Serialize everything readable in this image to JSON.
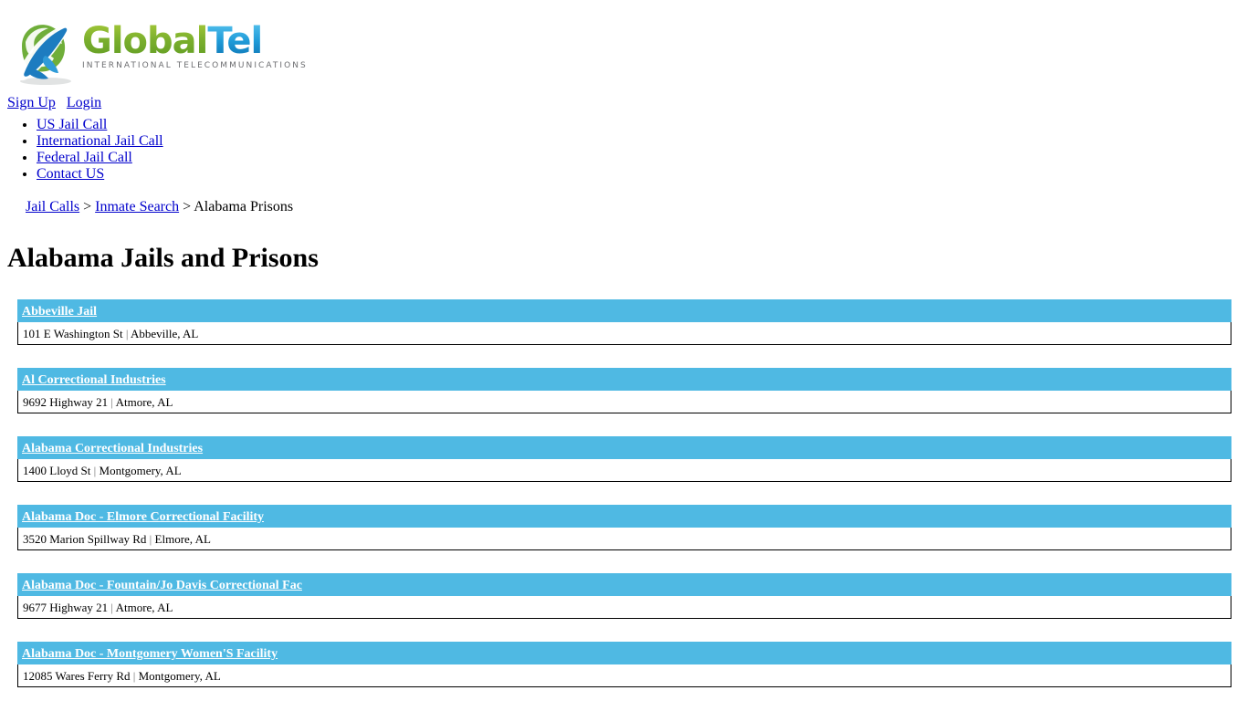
{
  "brand": {
    "logo_icon": "globe-swoosh-icon",
    "name_part1": "Global",
    "name_part2": "Tel",
    "tagline": "INTERNATIONAL TELECOMMUNICATIONS",
    "green": "#7cb02e",
    "blue": "#1f9bd8"
  },
  "account": {
    "signup_label": "Sign Up",
    "login_label": "Login"
  },
  "nav": {
    "items": [
      {
        "label": "US Jail Call"
      },
      {
        "label": "International Jail Call"
      },
      {
        "label": "Federal Jail Call"
      },
      {
        "label": "Contact US"
      }
    ]
  },
  "breadcrumb": {
    "items": [
      {
        "label": "Jail Calls",
        "link": true
      },
      {
        "label": "Inmate Search",
        "link": true
      },
      {
        "label": "Alabama Prisons",
        "link": false
      }
    ],
    "separator": ">"
  },
  "page": {
    "title": "Alabama Jails and Prisons",
    "accent_color": "#4fb9e3"
  },
  "facilities": [
    {
      "name": "Abbeville Jail",
      "street": "101 E Washington St",
      "city_state": "Abbeville, AL"
    },
    {
      "name": "Al Correctional Industries",
      "street": "9692 Highway 21",
      "city_state": "Atmore, AL"
    },
    {
      "name": "Alabama Correctional Industries",
      "street": "1400 Lloyd St",
      "city_state": "Montgomery, AL"
    },
    {
      "name": "Alabama Doc - Elmore Correctional Facility",
      "street": "3520 Marion Spillway Rd",
      "city_state": "Elmore, AL"
    },
    {
      "name": "Alabama Doc - Fountain/Jo Davis Correctional Fac",
      "street": "9677 Highway 21",
      "city_state": "Atmore, AL"
    },
    {
      "name": "Alabama Doc - Montgomery Women'S Facility",
      "street": "12085 Wares Ferry Rd",
      "city_state": "Montgomery, AL"
    }
  ]
}
